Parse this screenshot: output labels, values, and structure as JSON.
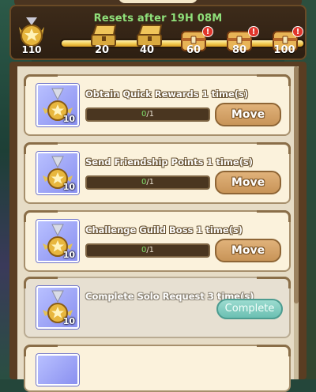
{
  "header": {
    "reset_text": "Resets after 19H  08M"
  },
  "rewards": {
    "points": "110",
    "progress_fraction": 1.0,
    "milestones": [
      {
        "value": "20",
        "chest": "open-chest",
        "alert": false
      },
      {
        "value": "40",
        "chest": "open-chest",
        "alert": false
      },
      {
        "value": "60",
        "chest": "closed-chest",
        "alert": true
      },
      {
        "value": "80",
        "chest": "closed-chest",
        "alert": true
      },
      {
        "value": "100",
        "chest": "closed-chest",
        "alert": true
      }
    ],
    "alert_glyph": "!"
  },
  "quests": [
    {
      "title": "Obtain Quick Rewards 1 time(s)",
      "current": "0",
      "total": "/1",
      "icon_count": "10",
      "button": "Move"
    },
    {
      "title": "Send Friendship Points 1 time(s)",
      "current": "0",
      "total": "/1",
      "icon_count": "10",
      "button": "Move"
    },
    {
      "title": "Challenge Guild Boss 1 time(s)",
      "current": "0",
      "total": "/1",
      "icon_count": "10",
      "button": "Move"
    },
    {
      "title": "Complete Solo Request 3 time(s)",
      "icon_count": "10",
      "button": "Complete"
    }
  ],
  "colors": {
    "accent_green": "#8fe07a",
    "alert_red": "#e0352b",
    "move_button": "#c89458",
    "complete_button": "#6bbfb2"
  }
}
